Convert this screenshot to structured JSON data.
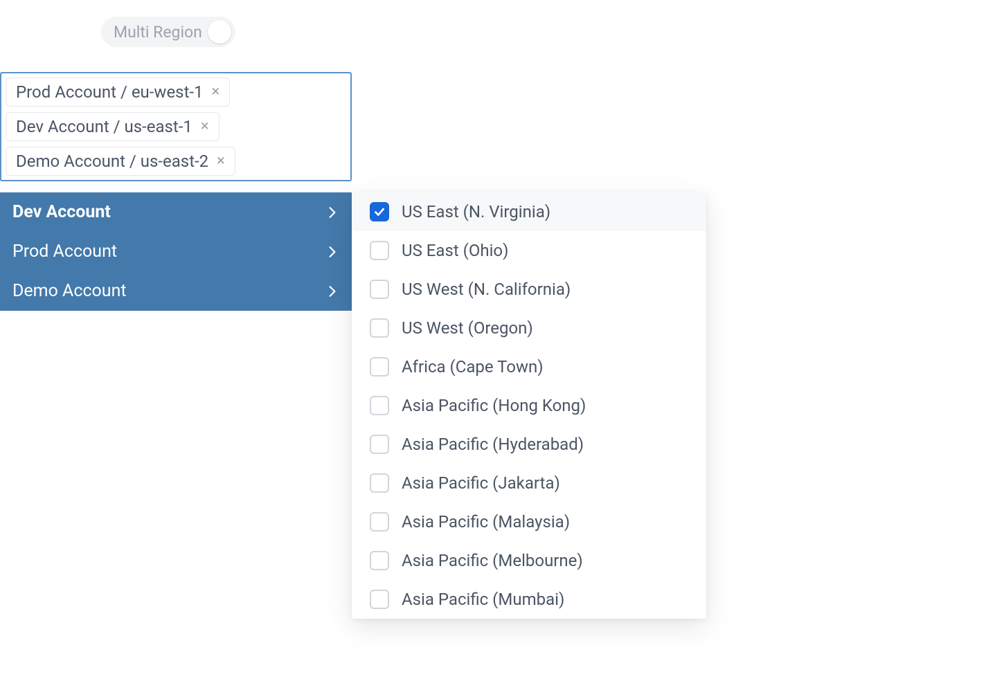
{
  "toggle": {
    "label": "Multi Region",
    "on": false
  },
  "selected_tags": [
    {
      "label": "Prod Account / eu-west-1"
    },
    {
      "label": "Dev Account / us-east-1"
    },
    {
      "label": "Demo Account / us-east-2"
    }
  ],
  "accounts": [
    {
      "label": "Dev Account",
      "active": true
    },
    {
      "label": "Prod Account",
      "active": false
    },
    {
      "label": "Demo Account",
      "active": false
    }
  ],
  "regions": [
    {
      "label": "US East (N. Virginia)",
      "checked": true,
      "highlight": true
    },
    {
      "label": "US East (Ohio)",
      "checked": false,
      "highlight": false
    },
    {
      "label": "US West (N. California)",
      "checked": false,
      "highlight": false
    },
    {
      "label": "US West (Oregon)",
      "checked": false,
      "highlight": false
    },
    {
      "label": "Africa (Cape Town)",
      "checked": false,
      "highlight": false
    },
    {
      "label": "Asia Pacific (Hong Kong)",
      "checked": false,
      "highlight": false
    },
    {
      "label": "Asia Pacific (Hyderabad)",
      "checked": false,
      "highlight": false
    },
    {
      "label": "Asia Pacific (Jakarta)",
      "checked": false,
      "highlight": false
    },
    {
      "label": "Asia Pacific (Malaysia)",
      "checked": false,
      "highlight": false
    },
    {
      "label": "Asia Pacific (Melbourne)",
      "checked": false,
      "highlight": false
    },
    {
      "label": "Asia Pacific (Mumbai)",
      "checked": false,
      "highlight": false
    }
  ]
}
